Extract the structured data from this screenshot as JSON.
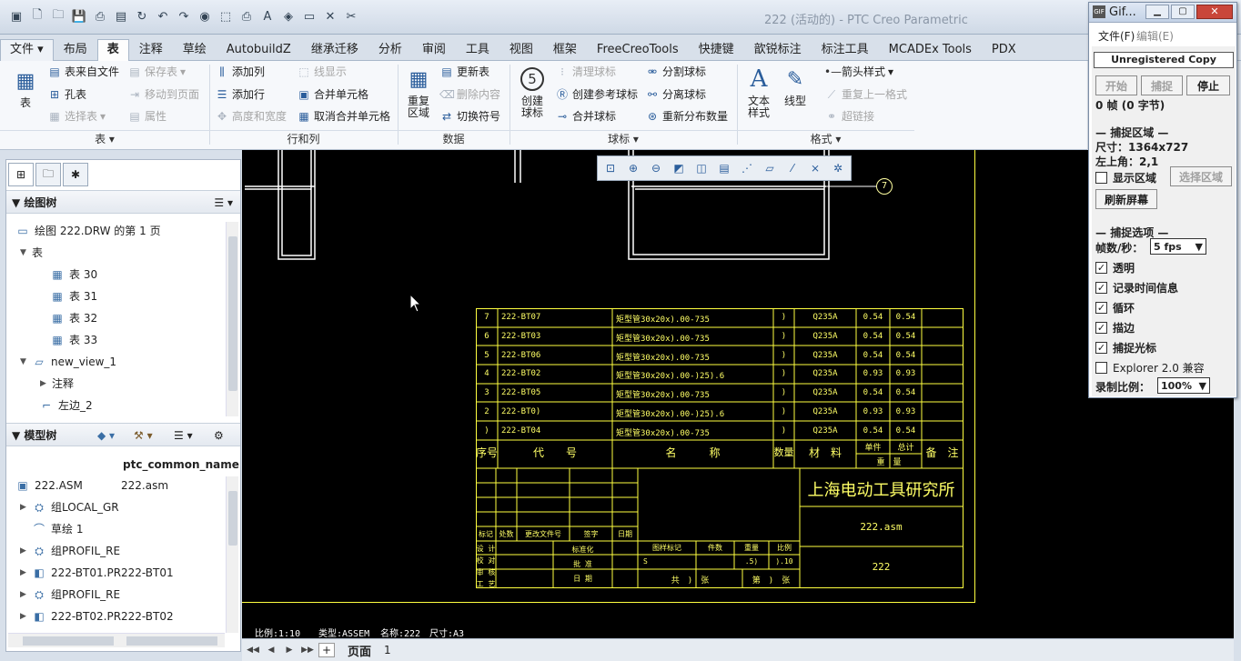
{
  "app": {
    "title": "222 (活动的) - PTC Creo Parametric"
  },
  "tabs": [
    "文件",
    "布局",
    "表",
    "注释",
    "草绘",
    "AutobuildZ",
    "继承迁移",
    "分析",
    "审阅",
    "工具",
    "视图",
    "框架",
    "FreeCreoTools",
    "快捷键",
    "歆锐标注",
    "标注工具",
    "MCADEx Tools",
    "PDX"
  ],
  "ribbon": {
    "table_btn": "表",
    "table_from_file": "表来自文件",
    "save_table": "保存表",
    "hole_table": "孔表",
    "move_to_page": "移动到页面",
    "select_table": "选择表",
    "properties": "属性",
    "add_column": "添加列",
    "add_row": "添加行",
    "height_width": "高度和宽度",
    "line_display": "线显示",
    "merge_cells": "合并单元格",
    "unmerge_cells": "取消合并单元格",
    "repeat_region": "重复区域",
    "update_table": "更新表",
    "delete_content": "删除内容",
    "switch_symbol": "切换符号",
    "create_balloon": "创建球标",
    "clear_balloon": "清理球标",
    "create_ref_balloon": "创建参考球标",
    "merge_balloon": "合并球标",
    "split_balloon": "分割球标",
    "detach_balloon": "分离球标",
    "redistribute_qty": "重新分布数量",
    "text_style": "文本样式",
    "line_style": "线型",
    "arrow_style": "箭头样式",
    "repeat_last_format": "重复上一格式",
    "hyperlink": "超链接",
    "groups": {
      "table": "表",
      "rows_cols": "行和列",
      "data": "数据",
      "balloon": "球标",
      "format": "格式"
    }
  },
  "drawing_tree": {
    "header": "绘图树",
    "items": [
      {
        "label": "绘图 222.DRW 的第 1 页"
      },
      {
        "label": "表"
      },
      {
        "label": "表 30"
      },
      {
        "label": "表 31"
      },
      {
        "label": "表 32"
      },
      {
        "label": "表 33"
      },
      {
        "label": "new_view_1"
      },
      {
        "label": "注释"
      },
      {
        "label": "左边_2"
      }
    ]
  },
  "model_tree": {
    "header": "模型树",
    "column": "ptc_common_name",
    "items": [
      {
        "label": "222.ASM",
        "col": "222.asm"
      },
      {
        "label": "组LOCAL_GR",
        "col": ""
      },
      {
        "label": "草绘 1",
        "col": ""
      },
      {
        "label": "组PROFIL_RE",
        "col": ""
      },
      {
        "label": "222-BT01.PR",
        "col": "222-BT01"
      },
      {
        "label": "组PROFIL_RE",
        "col": ""
      },
      {
        "label": "222-BT02.PR",
        "col": "222-BT02"
      }
    ]
  },
  "bom": {
    "rows": [
      {
        "no": "7",
        "code": "222-BT07",
        "name": "矩型管30x20x).00-735",
        "qty": ")",
        "mat": "Q235A",
        "unit": "0.54",
        "total": "0.54"
      },
      {
        "no": "6",
        "code": "222-BT03",
        "name": "矩型管30x20x).00-735",
        "qty": ")",
        "mat": "Q235A",
        "unit": "0.54",
        "total": "0.54"
      },
      {
        "no": "5",
        "code": "222-BT06",
        "name": "矩型管30x20x).00-735",
        "qty": ")",
        "mat": "Q235A",
        "unit": "0.54",
        "total": "0.54"
      },
      {
        "no": "4",
        "code": "222-BT02",
        "name": "矩型管30x20x).00-)25).6",
        "qty": ")",
        "mat": "Q235A",
        "unit": "0.93",
        "total": "0.93"
      },
      {
        "no": "3",
        "code": "222-BT05",
        "name": "矩型管30x20x).00-735",
        "qty": ")",
        "mat": "Q235A",
        "unit": "0.54",
        "total": "0.54"
      },
      {
        "no": "2",
        "code": "222-BT0)",
        "name": "矩型管30x20x).00-)25).6",
        "qty": ")",
        "mat": "Q235A",
        "unit": "0.93",
        "total": "0.93"
      },
      {
        "no": ")",
        "code": "222-BT04",
        "name": "矩型管30x20x).00-735",
        "qty": ")",
        "mat": "Q235A",
        "unit": "0.54",
        "total": "0.54"
      }
    ],
    "headers": {
      "no": "序号",
      "code": "代　　号",
      "name": "名　　　称",
      "qty": "数量",
      "mat": "材　料",
      "unit": "单件",
      "total": "总计",
      "weight": "重　量",
      "remark": "备　注"
    }
  },
  "titleblock": {
    "institute": "上海电动工具研究所",
    "file": "222.asm",
    "drawing_no": "222",
    "change_row": [
      "标记",
      "处数",
      "更改文件号",
      "签字",
      "日期"
    ],
    "left_labels": [
      "设 计",
      "校 对",
      "审 核",
      "工 艺"
    ],
    "mid_labels": [
      "标准化",
      "批 准",
      "日 期"
    ],
    "stage_header": [
      "图样标记",
      "件数",
      "重量",
      "比例"
    ],
    "stage_values": [
      "S",
      "",
      ".5)",
      ").10"
    ],
    "sheet_info": [
      "共　)　张",
      "第　)　张"
    ]
  },
  "balloon": "7",
  "status": {
    "scale": "比例:1:10",
    "type": "类型:ASSEM",
    "name": "名称:222",
    "size": "尺寸:A3"
  },
  "pages": {
    "label": "页面",
    "num": "1"
  },
  "gif": {
    "title": "Gif...",
    "menu_file": "文件(F)",
    "menu_edit": "编辑(E)",
    "unregistered": "Unregistered Copy",
    "start": "开始",
    "capture": "捕捉",
    "stop": "停止",
    "frames": "0 帧 (0 字节)",
    "section_area": "捕捉区域",
    "size": "尺寸：1364x727",
    "topleft": "左上角：2,1",
    "show_area": "显示区域",
    "select_area": "选择区域",
    "refresh": "刷新屏幕",
    "section_opts": "捕捉选项",
    "fps_label": "帧数/秒：",
    "fps_value": "5 fps",
    "transparent": "透明",
    "timing": "记录时间信息",
    "loop": "循环",
    "border": "描边",
    "cursor": "捕捉光标",
    "explorer": "Explorer 2.0 兼容",
    "ratio_label": "录制比例：",
    "ratio_value": "100%"
  }
}
